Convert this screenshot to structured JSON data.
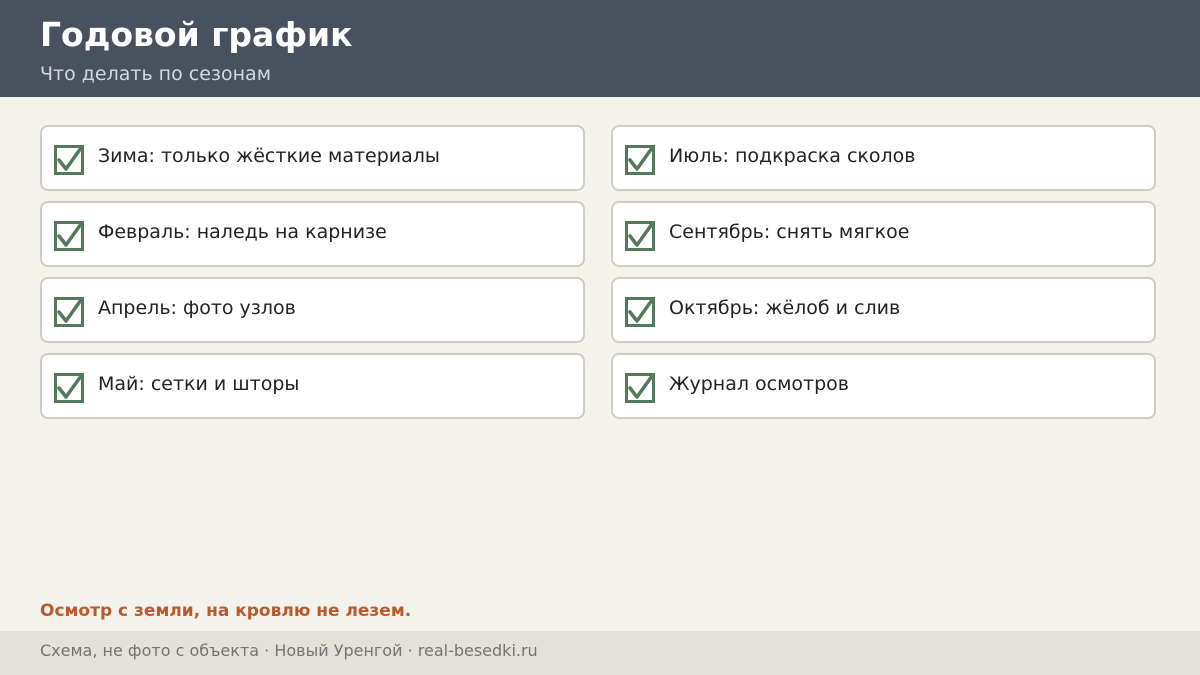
{
  "header": {
    "title": "Годовой график",
    "subtitle": "Что делать по сезонам"
  },
  "colors": {
    "header_bg": "#48515d",
    "check": "#527a5a",
    "note": "#b85a2a"
  },
  "checklist": [
    {
      "label": "Зима: только жёсткие материалы",
      "checked": true,
      "icon": "checked-checkbox-icon"
    },
    {
      "label": "Июль: подкраска сколов",
      "checked": true,
      "icon": "checked-checkbox-icon"
    },
    {
      "label": "Февраль: наледь на карнизе",
      "checked": true,
      "icon": "checked-checkbox-icon"
    },
    {
      "label": "Сентябрь: снять мягкое",
      "checked": true,
      "icon": "checked-checkbox-icon"
    },
    {
      "label": "Апрель: фото узлов",
      "checked": true,
      "icon": "checked-checkbox-icon"
    },
    {
      "label": "Октябрь: жёлоб и слив",
      "checked": true,
      "icon": "checked-checkbox-icon"
    },
    {
      "label": "Май: сетки и шторы",
      "checked": true,
      "icon": "checked-checkbox-icon"
    },
    {
      "label": "Журнал осмотров",
      "checked": true,
      "icon": "checked-checkbox-icon"
    }
  ],
  "note": "Осмотр с земли, на кровлю не лезем.",
  "footer": {
    "text": "Схема, не фото с объекта  ·  Новый Уренгой  ·  real-besedki.ru"
  }
}
